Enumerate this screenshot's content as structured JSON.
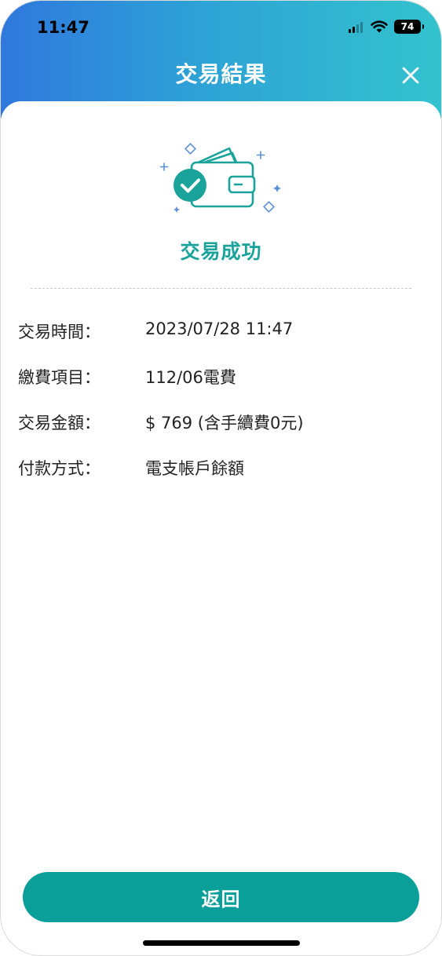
{
  "status_bar": {
    "time": "11:47",
    "battery": "74",
    "icons": [
      "cellular-signal-icon",
      "wifi-icon",
      "battery-icon"
    ]
  },
  "nav": {
    "title": "交易結果",
    "close_icon": "close-icon"
  },
  "result": {
    "icon": "wallet-success-icon",
    "title": "交易成功"
  },
  "details": [
    {
      "label": "交易時間：",
      "value": "2023/07/28 11:47"
    },
    {
      "label": "繳費項目：",
      "value": "112/06電費"
    },
    {
      "label": "交易金額：",
      "value": "$ 769 (含手續費0元)"
    },
    {
      "label": "付款方式：",
      "value": "電支帳戶餘額"
    }
  ],
  "footer": {
    "return_label": "返回"
  },
  "colors": {
    "header_gradient_start": "#2f78dd",
    "header_gradient_end": "#33c3cd",
    "accent": "#1aa39a",
    "button": "#0aa099"
  }
}
